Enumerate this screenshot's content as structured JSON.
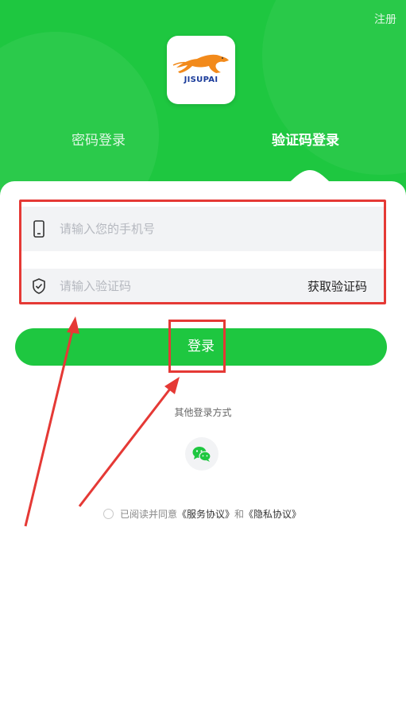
{
  "header": {
    "register": "注册",
    "logo_text": "JISUPAI",
    "tabs": [
      {
        "label": "密码登录",
        "active": false
      },
      {
        "label": "验证码登录",
        "active": true
      }
    ]
  },
  "form": {
    "phone": {
      "placeholder": "请输入您的手机号",
      "value": "",
      "icon": "phone-icon"
    },
    "code": {
      "placeholder": "请输入验证码",
      "value": "",
      "icon": "shield-check-icon"
    },
    "get_code_label": "获取验证码"
  },
  "login_button_label": "登录",
  "other_login_label": "其他登录方式",
  "wechat_icon": "wechat-icon",
  "agreement": {
    "prefix": "已阅读并同意",
    "service": "《服务协议》",
    "and": "和",
    "privacy": "《隐私协议》"
  },
  "colors": {
    "brand_green": "#1ec740",
    "annotation_red": "#e53935"
  }
}
